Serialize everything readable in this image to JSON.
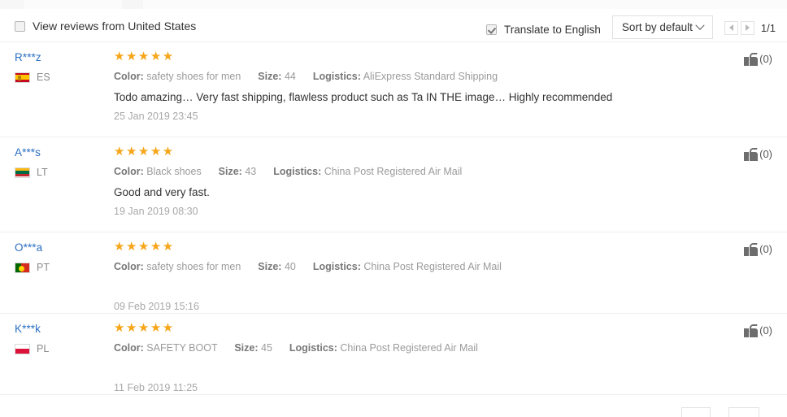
{
  "toolbar": {
    "view_reviews_label": "View reviews from United States",
    "view_reviews_checked": false,
    "translate_label": "Translate to English",
    "translate_checked": true,
    "sort_label": "Sort by default",
    "page_indicator": "1/1",
    "prev_icon": "caret-left-icon",
    "next_icon": "caret-right-icon"
  },
  "labels": {
    "color": "Color:",
    "size": "Size:",
    "logistics": "Logistics:"
  },
  "colors": {
    "star": "#f7a519",
    "username": "#2b6fc2",
    "meta_label": "#777777",
    "meta_value": "#9b9b9b",
    "divider": "#eeeeee"
  },
  "reviews": [
    {
      "username": "R***z",
      "country_code": "ES",
      "flag": "spain-flag",
      "rating": 5,
      "stars": "★★★★★",
      "color": "safety shoes for men",
      "size": "44",
      "logistics": "AliExpress Standard Shipping",
      "content": "Todo amazing… Very fast shipping, flawless product such as Ta IN THE image… Highly recommended",
      "date": "25 Jan 2019 23:45",
      "helpful_count": "(0)"
    },
    {
      "username": "A***s",
      "country_code": "LT",
      "flag": "lithuania-flag",
      "rating": 5,
      "stars": "★★★★★",
      "color": "Black shoes",
      "size": "43",
      "logistics": "China Post Registered Air Mail",
      "content": "Good and very fast.",
      "date": "19 Jan 2019 08:30",
      "helpful_count": "(0)"
    },
    {
      "username": "O***a",
      "country_code": "PT",
      "flag": "portugal-flag",
      "rating": 5,
      "stars": "★★★★★",
      "color": "safety shoes for men",
      "size": "40",
      "logistics": "China Post Registered Air Mail",
      "content": "",
      "date": "09 Feb 2019 15:16",
      "helpful_count": "(0)"
    },
    {
      "username": "K***k",
      "country_code": "PL",
      "flag": "poland-flag",
      "rating": 5,
      "stars": "★★★★★",
      "color": "SAFETY BOOT",
      "size": "45",
      "logistics": "China Post Registered Air Mail",
      "content": "",
      "date": "11 Feb 2019 11:25",
      "helpful_count": "(0)"
    }
  ]
}
